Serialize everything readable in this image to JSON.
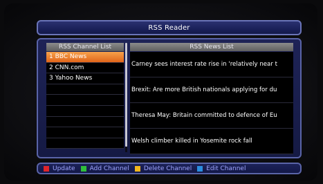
{
  "title": "RSS Reader",
  "channel_panel": {
    "header": "RSS Channel List",
    "items": [
      {
        "label": "1  BBC News",
        "selected": true
      },
      {
        "label": "2  CNN.com",
        "selected": false
      },
      {
        "label": "3  Yahoo News",
        "selected": false
      },
      {
        "label": "",
        "selected": false
      },
      {
        "label": "",
        "selected": false
      },
      {
        "label": "",
        "selected": false
      },
      {
        "label": "",
        "selected": false
      },
      {
        "label": "",
        "selected": false
      },
      {
        "label": "",
        "selected": false
      }
    ]
  },
  "news_panel": {
    "header": "RSS News List",
    "items": [
      "Carney sees interest rate rise in 'relatively near t",
      "Brexit: Are more British nationals applying for du",
      "Theresa May: Britain committed to defence of Eu",
      "Welsh climber killed in Yosemite rock fall"
    ]
  },
  "footer": {
    "keys": [
      {
        "color": "#e0242a",
        "icon": "red-square-icon",
        "label": "Update"
      },
      {
        "color": "#2fbf3a",
        "icon": "green-square-icon",
        "label": "Add Channel"
      },
      {
        "color": "#f2b61c",
        "icon": "yellow-square-icon",
        "label": "Delete Channel"
      },
      {
        "color": "#2a8ee0",
        "icon": "blue-square-icon",
        "label": "Edit Channel"
      }
    ]
  }
}
